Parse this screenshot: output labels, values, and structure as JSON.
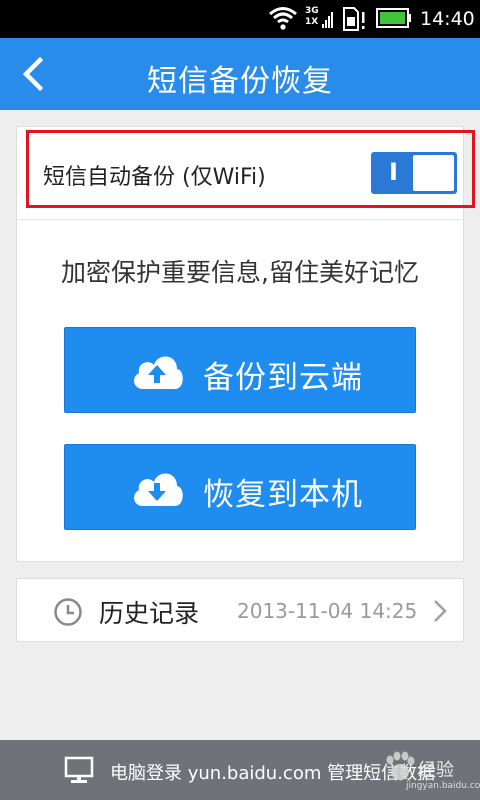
{
  "status_bar": {
    "network_top": "3G",
    "network_bottom": "1X",
    "time": "14:40",
    "icons": [
      "wifi-icon",
      "signal-icon",
      "sim-card-icon",
      "battery-icon"
    ]
  },
  "header": {
    "title": "短信备份恢复",
    "back_icon": "chevron-left-icon"
  },
  "auto_backup": {
    "label": "短信自动备份 (仅WiFi)",
    "switch_mark": "I",
    "enabled": true
  },
  "tagline": "加密保护重要信息,留住美好记忆",
  "buttons": {
    "backup_label": "备份到云端",
    "restore_label": "恢复到本机"
  },
  "history": {
    "label": "历史记录",
    "last_time": "2013-11-04 14:25"
  },
  "footer": {
    "text": "电脑登录 yun.baidu.com 管理短信数据"
  },
  "watermark": {
    "text": "经验",
    "sub": "jingyan.baidu.com"
  },
  "colors": {
    "primary": "#2a8cea",
    "button": "#1f8cf0",
    "highlight": "#e2141e",
    "footer": "#6f7277"
  }
}
